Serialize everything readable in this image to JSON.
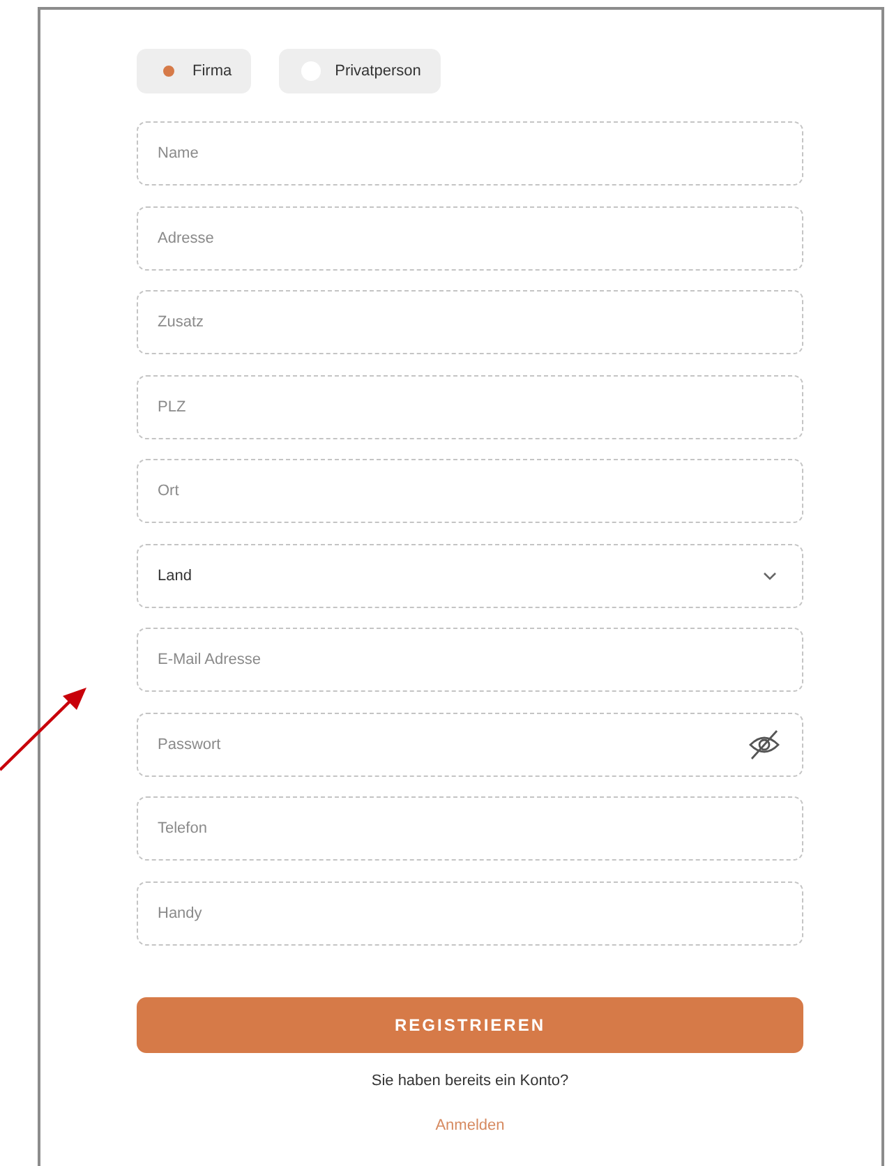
{
  "account_type": [
    {
      "label": "Firma",
      "selected": true
    },
    {
      "label": "Privatperson",
      "selected": false
    }
  ],
  "fields": [
    {
      "kind": "text",
      "placeholder": "Name"
    },
    {
      "kind": "text",
      "placeholder": "Adresse"
    },
    {
      "kind": "text",
      "placeholder": "Zusatz"
    },
    {
      "kind": "text",
      "placeholder": "PLZ"
    },
    {
      "kind": "text",
      "placeholder": "Ort"
    },
    {
      "kind": "select",
      "value": "Land"
    },
    {
      "kind": "text",
      "placeholder": "E-Mail Adresse"
    },
    {
      "kind": "password",
      "placeholder": "Passwort"
    },
    {
      "kind": "text",
      "placeholder": "Telefon"
    },
    {
      "kind": "text",
      "placeholder": "Handy"
    }
  ],
  "submit_button": "REGISTRIEREN",
  "login_prompt": "Sie haben bereits ein Konto?",
  "login_link": "Anmelden"
}
